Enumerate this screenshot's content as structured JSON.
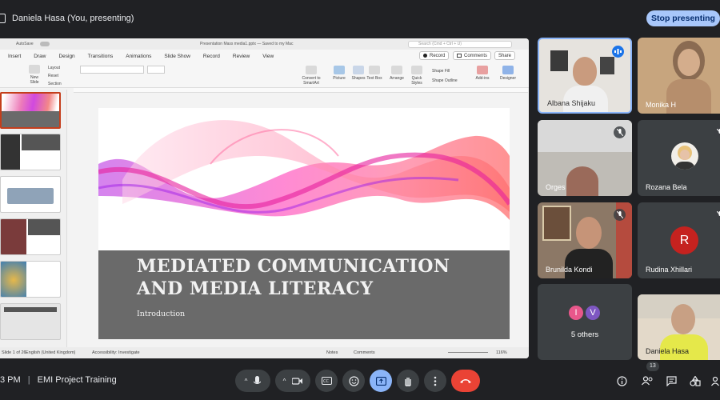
{
  "top": {
    "presenter_label": "Daniela Hasa (You, presenting)",
    "stop_presenting": "Stop presenting"
  },
  "ppt": {
    "autosave": "AutoSave",
    "document": "Presentation Mass media1.pptx — Saved to my Mac",
    "search_placeholder": "Search (Cmd + Ctrl + U)",
    "menu": [
      "Insert",
      "Draw",
      "Design",
      "Transitions",
      "Animations",
      "Slide Show",
      "Record",
      "Review",
      "View"
    ],
    "record_btn": "Record",
    "comments_btn": "Comments",
    "share_btn": "Share",
    "ribbon": {
      "new_slide": "New Slide",
      "layout": "Layout",
      "reset": "Reset",
      "section": "Section",
      "convert": "Convert to SmartArt",
      "picture": "Picture",
      "shapes": "Shapes",
      "text_box": "Text Box",
      "arrange": "Arrange",
      "quick_styles": "Quick Styles",
      "shape_fill": "Shape Fill",
      "shape_outline": "Shape Outline",
      "add_ins": "Add-ins",
      "designer": "Designer"
    },
    "slide": {
      "title": "MEDIATED COMMUNICATION AND MEDIA LITERACY",
      "subtitle": "Introduction"
    },
    "status": {
      "slide_of": "Slide 1 of 26",
      "language": "English (United Kingdom)",
      "accessibility": "Accessibility: Investigate",
      "notes": "Notes",
      "comments": "Comments",
      "zoom": "116%"
    }
  },
  "participants": [
    {
      "name": "Albana Shijaku",
      "speaking": true
    },
    {
      "name": "Monika H",
      "speaking": false
    },
    {
      "name": "Orges",
      "muted": true
    },
    {
      "name": "Rozana Bela",
      "muted": true
    },
    {
      "name": "Brunilda Kondi",
      "muted": true
    },
    {
      "name": "Rudina Xhillari",
      "muted": true,
      "initial": "R"
    },
    {
      "name": "5 others",
      "initials": [
        "I",
        "V"
      ]
    },
    {
      "name": "Daniela Hasa"
    }
  ],
  "bottom": {
    "time": "3 PM",
    "meeting_title": "EMI Project Training",
    "participants_count": "13"
  },
  "colors": {
    "accent": "#a8c7fa",
    "leave": "#ea4335",
    "present_active": "#8ab4f8"
  }
}
